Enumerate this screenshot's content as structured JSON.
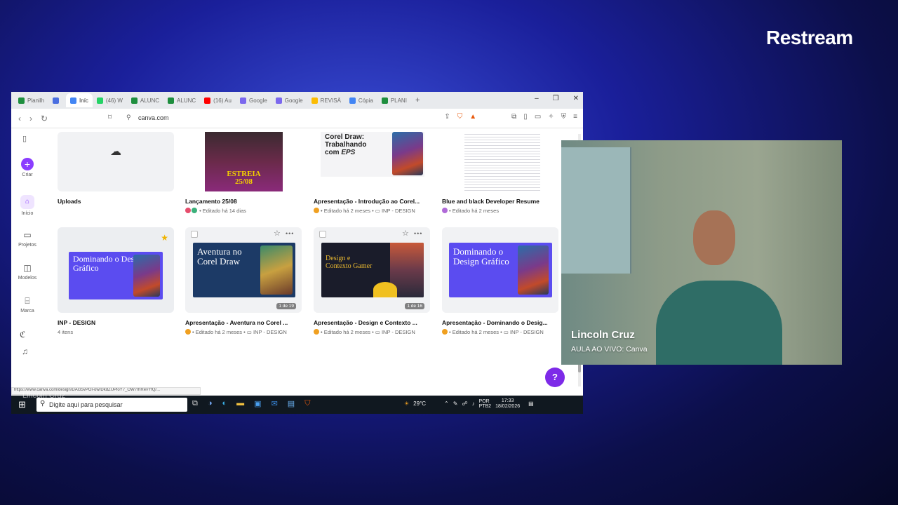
{
  "brand": "Restream",
  "browser": {
    "tabs": [
      {
        "label": "Planilh",
        "color": "#1e8e3e"
      },
      {
        "label": "",
        "color": "#4a6ee0"
      },
      {
        "label": "Iníc",
        "color": "#4285f4",
        "active": true
      },
      {
        "label": "(46) W",
        "color": "#25d366"
      },
      {
        "label": "ALUNC",
        "color": "#1e8e3e"
      },
      {
        "label": "ALUNC",
        "color": "#1e8e3e"
      },
      {
        "label": "(16) Au",
        "color": "#ff0000"
      },
      {
        "label": "Google",
        "color": "#7b68ee"
      },
      {
        "label": "Google",
        "color": "#7b68ee"
      },
      {
        "label": "REVISÃ",
        "color": "#fbbc04"
      },
      {
        "label": "Cópia",
        "color": "#4285f4"
      },
      {
        "label": "PLANI",
        "color": "#1e8e3e"
      }
    ],
    "new_tab": "+",
    "url": "canva.com"
  },
  "sidebar": {
    "criar": "Criar",
    "inicio": "Início",
    "projetos": "Projetos",
    "modelos": "Modelos",
    "marca": "Marca",
    "avatar_letter": "L"
  },
  "cards_row1": [
    {
      "title": "Uploads",
      "meta": ""
    },
    {
      "title": "Lançamento 25/08",
      "meta": "• Editado há 14 dias",
      "thumb_text": "ESTREIA\n25/08"
    },
    {
      "title": "Apresentação - Introdução ao Corel...",
      "meta": "• Editado há 2 meses • ",
      "folder": "INP - DESIGN",
      "thumb_text": "Corel Draw: Trabalhando com EPS"
    },
    {
      "title": "Blue and black  Developer Resume",
      "meta": "• Editado há 2 meses"
    }
  ],
  "cards_row2": [
    {
      "title": "INP - DESIGN",
      "meta": "4 itens",
      "thumb_text": "Dominando o Design Gráfico"
    },
    {
      "title": "Apresentação - Aventura no Corel ...",
      "meta": "• Editado há 2 meses • ",
      "folder": "INP - DESIGN",
      "thumb_text": "Aventura no Corel Draw",
      "badge": "1 de 19"
    },
    {
      "title": "Apresentação - Design e Contexto ...",
      "meta": "• Editado há 2 meses • ",
      "folder": "INP - DESIGN",
      "thumb_text": "Design e Contexto Gamer",
      "badge": "1 de 16"
    },
    {
      "title": "Apresentação - Dominando o Desig...",
      "meta": "• Editado há 2 meses • ",
      "folder": "INP - DESIGN",
      "thumb_text": "Dominando o Design Gráfico"
    }
  ],
  "help": "?",
  "status_url": "https://www.canva.com/design/DAG5vPOI-ow/DkdZUPloY7_OW7rhRevYfQ/...",
  "taskbar": {
    "search_placeholder": "Digite aqui para pesquisar",
    "weather": "29°C",
    "lang": "POR",
    "lang2": "PTB2",
    "time": "17:33",
    "date": "18/02/2026"
  },
  "overlay_name": "Lincoln Cruz",
  "camera": {
    "name": "Lincoln Cruz",
    "subtitle": "AULA AO VIVO: Canva"
  }
}
